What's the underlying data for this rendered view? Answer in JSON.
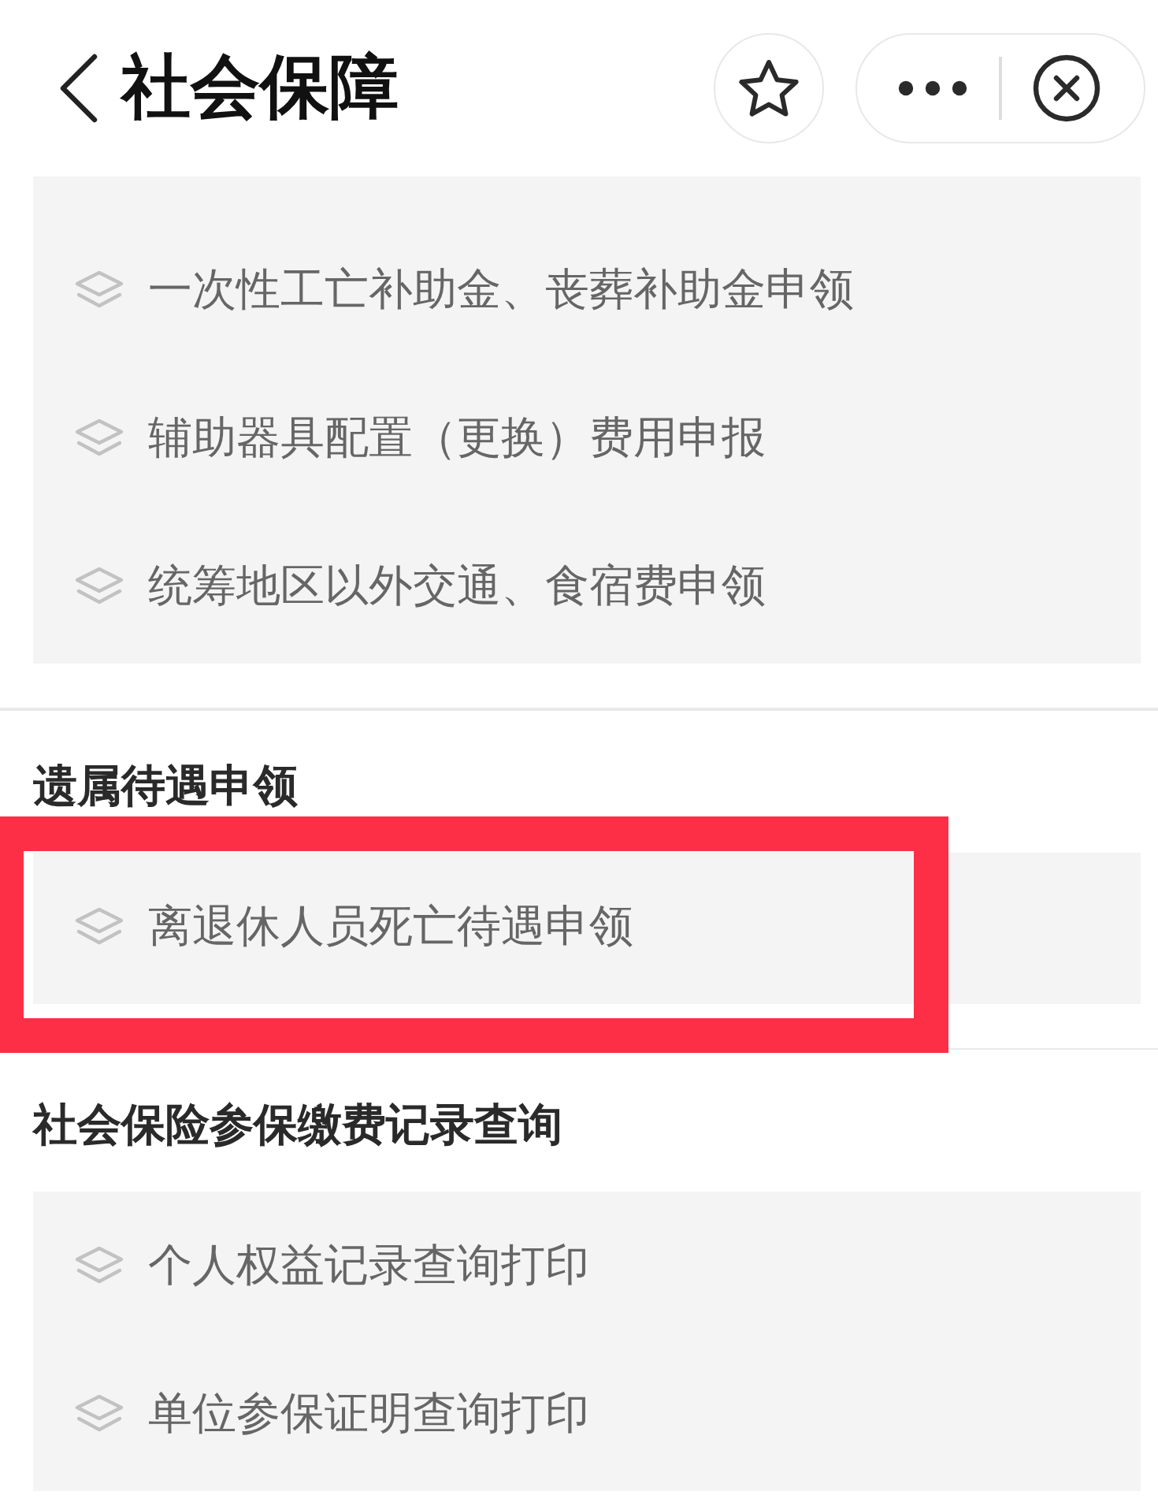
{
  "header": {
    "title": "社会保障"
  },
  "sections": [
    {
      "items": [
        {
          "label": "一次性工亡补助金、丧葬补助金申领",
          "highlighted": false
        },
        {
          "label": "辅助器具配置（更换）费用申报",
          "highlighted": false
        },
        {
          "label": "统筹地区以外交通、食宿费申领",
          "highlighted": false
        }
      ]
    },
    {
      "title": "遗属待遇申领",
      "items": [
        {
          "label": "离退休人员死亡待遇申领",
          "highlighted": true
        }
      ]
    },
    {
      "title": "社会保险参保缴费记录查询",
      "items": [
        {
          "label": "个人权益记录查询打印",
          "highlighted": false
        },
        {
          "label": "单位参保证明查询打印",
          "highlighted": false
        }
      ]
    }
  ]
}
